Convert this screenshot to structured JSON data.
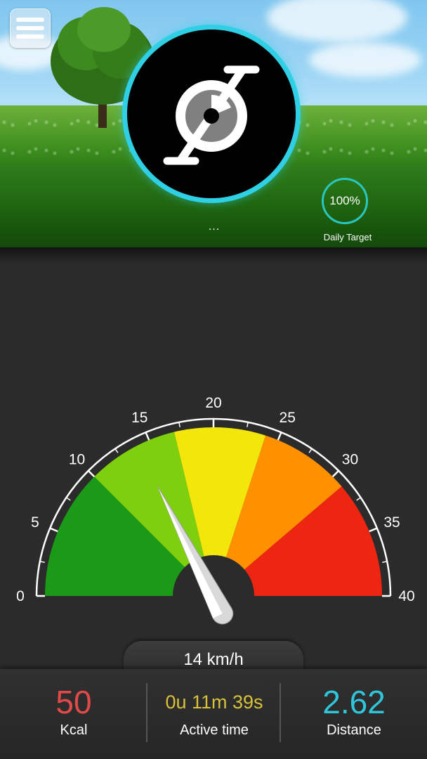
{
  "header": {
    "daily_target_value": "100%",
    "daily_target_label": "Daily Target",
    "page_indicator": "...",
    "ring_color": "#2fd0e6",
    "target_ring_color": "#29c7c0"
  },
  "gauge": {
    "tick_labels": [
      "0",
      "5",
      "10",
      "15",
      "20",
      "25",
      "30",
      "35",
      "40"
    ],
    "min": 0,
    "max": 40,
    "current_speed": 14,
    "zones": [
      {
        "from": 0,
        "to": 10,
        "color": "#1a9a16"
      },
      {
        "from": 10,
        "to": 17,
        "color": "#7ed00f"
      },
      {
        "from": 17,
        "to": 24,
        "color": "#f3e60b"
      },
      {
        "from": 24,
        "to": 31,
        "color": "#ff9000"
      },
      {
        "from": 31,
        "to": 40,
        "color": "#ee2511"
      }
    ]
  },
  "speed": {
    "label": "14 km/h"
  },
  "stats": {
    "kcal": {
      "value": "50",
      "label": "Kcal",
      "color": "#e24a4a"
    },
    "active_time": {
      "value": "0u 11m 39s",
      "label": "Active time",
      "color": "#d9c23a"
    },
    "distance": {
      "value": "2.62",
      "label": "Distance",
      "color": "#2fc6dc"
    }
  },
  "icons": {
    "menu": "hamburger-icon",
    "logo": "cyclometer-logo-icon"
  }
}
